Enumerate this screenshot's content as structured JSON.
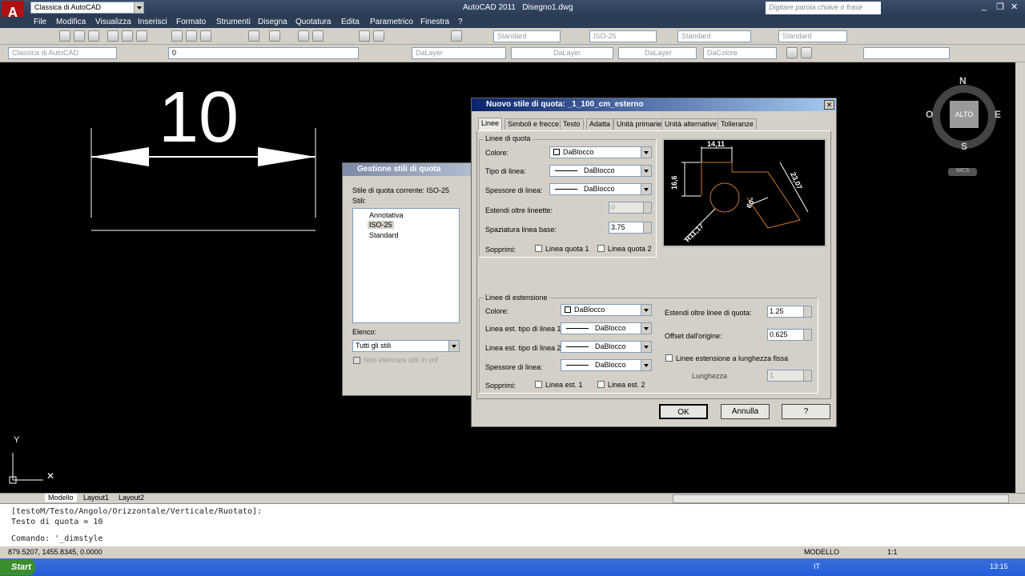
{
  "app": {
    "title": "AutoCAD 2011",
    "file": "Disegno1.dwg",
    "workspace": "Classica di AutoCAD",
    "search_placeholder": "Digitare parola chiave o frase"
  },
  "menu": [
    "File",
    "Modifica",
    "Visualizza",
    "Inserisci",
    "Formato",
    "Strumenti",
    "Disegna",
    "Quotatura",
    "Edita",
    "Parametrico",
    "Finestra",
    "?"
  ],
  "toolbar": {
    "text_style": "Standard",
    "dim_style": "ISO-25",
    "table_style": "Standard",
    "mleader_style": "Standard",
    "workspace2": "Classica di AutoCAD",
    "layer": "0",
    "color": "DaLayer",
    "linetype": "DaLayer",
    "lineweight": "DaLayer",
    "plotstyle": "DaColore"
  },
  "drawing": {
    "dim_text": "10"
  },
  "viewcube": {
    "n": "N",
    "s": "S",
    "e": "E",
    "o": "O",
    "face": "ALTO",
    "wcs": "WCS"
  },
  "ucs": {
    "y": "Y"
  },
  "layout_tabs": [
    "Modello",
    "Layout1",
    "Layout2"
  ],
  "command": {
    "line1": "[testoM/Testo/Angolo/Orizzontale/Verticale/Ruotato]:",
    "line2": "Testo di quota = 10",
    "line3": "Comando:  '_dimstyle"
  },
  "status": {
    "coords": "879.5207, 1455.8345, 0.0000",
    "model": "MODELLO",
    "scale": "1:1"
  },
  "taskbar": {
    "start": "Start",
    "lang": "IT",
    "time": "13:15"
  },
  "manager": {
    "title": "Gestione stili di quota",
    "current": "Stile di quota corrente: ISO-25",
    "styles_label": "Stili:",
    "styles": [
      "Annotativa",
      "ISO-25",
      "Standard"
    ],
    "list_label": "Elenco:",
    "list_value": "Tutti gli stili",
    "xref": "Non elencare stili in xrif"
  },
  "dialog": {
    "title": "Nuovo stile di quota: _1_100_cm_esterno",
    "tabs": [
      "Linee",
      "Simboli e frecce",
      "Testo",
      "Adatta",
      "Unità primarie",
      "Unità alternative",
      "Tolleranze"
    ],
    "dimlines": {
      "group": "Linee di quota",
      "color_label": "Colore:",
      "color": "DaBlocco",
      "linetype_label": "Tipo di linea:",
      "linetype": "DaBlocco",
      "lineweight_label": "Spessore di linea:",
      "lineweight": "DaBlocco",
      "extend_label": "Estendi oltre lineette:",
      "extend": "0",
      "baseline_label": "Spaziatura linea base:",
      "baseline": "3.75",
      "suppress_label": "Sopprimi:",
      "sup1": "Linea quota 1",
      "sup2": "Linea quota 2"
    },
    "extlines": {
      "group": "Linee di estensione",
      "color_label": "Colore:",
      "color": "DaBlocco",
      "lt1_label": "Linea est. tipo di linea 1:",
      "lt1": "DaBlocco",
      "lt2_label": "Linea est. tipo di linea 2:",
      "lt2": "DaBlocco",
      "lw_label": "Spessore di linea:",
      "lw": "DaBlocco",
      "suppress_label": "Sopprimi:",
      "sup1": "Linea est. 1",
      "sup2": "Linea est. 2",
      "beyond_label": "Estendi oltre linee di quota:",
      "beyond": "1.25",
      "offset_label": "Offset dall'origine:",
      "offset": "0.625",
      "fixed_label": "Linee estensione a lunghezza fissa",
      "length_label": "Lunghezza",
      "length": "1"
    },
    "preview": {
      "d1": "14,11",
      "d2": "16,6",
      "d3": "23,07",
      "d4": "60°",
      "d5": "R11,17"
    },
    "ok": "OK",
    "cancel": "Annulla",
    "help": "?"
  }
}
